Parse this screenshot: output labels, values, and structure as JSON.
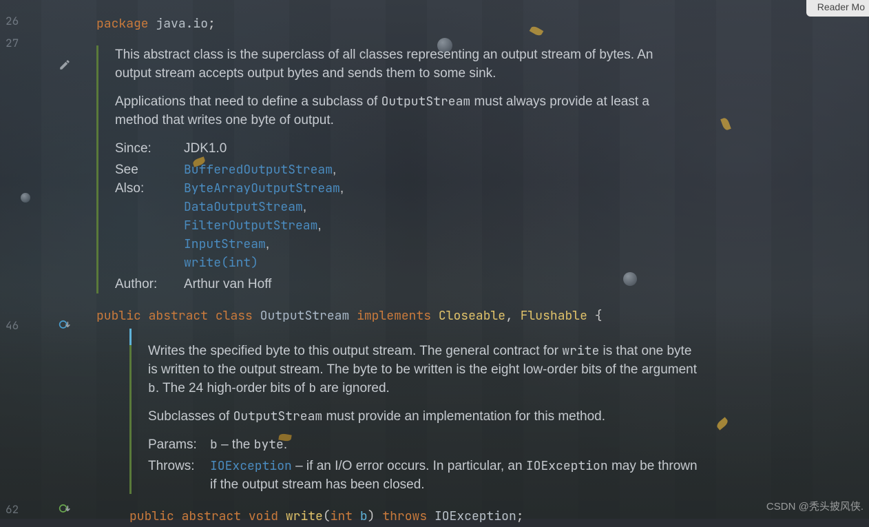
{
  "reader_mode_label": "Reader Mo",
  "line_numbers": {
    "l1": "26",
    "l2": "27",
    "l3": "46",
    "l4": "62"
  },
  "code": {
    "pkg_kw": "package",
    "pkg_name": "java.io",
    "semi": ";",
    "public": "public",
    "abstract": "abstract",
    "class": "class",
    "void": "void",
    "implements": "implements",
    "throws": "throws",
    "OutputStream": "OutputStream",
    "Closeable": "Closeable",
    "Flushable": "Flushable",
    "comma_sp": ", ",
    "lbrace": " {",
    "write": "write",
    "lparen": "(",
    "int": "int",
    "b": "b",
    "rparen": ")",
    "IOException": "IOException"
  },
  "doc1": {
    "p1": "This abstract class is the superclass of all classes representing an output stream of bytes. An output stream accepts output bytes and sends them to some sink.",
    "p2a": "Applications that need to define a subclass of ",
    "p2b": " must always provide at least a method that writes one byte of output.",
    "since_label": "Since:",
    "since_val": "JDK1.0",
    "see_label": "See Also:",
    "see_links": [
      "BufferedOutputStream",
      "ByteArrayOutputStream",
      "DataOutputStream",
      "FilterOutputStream",
      "InputStream",
      "write(int)"
    ],
    "author_label": "Author:",
    "author_val": "Arthur van Hoff"
  },
  "doc2": {
    "p1a": "Writes the specified byte to this output stream. The general contract for ",
    "p1b": " is that one byte is written to the output stream. The byte to be written is the eight low-order bits of the argument ",
    "p1c": ". The 24 high-order bits of ",
    "p1d": " are ignored.",
    "p2a": "Subclasses of ",
    "p2b": " must provide an implementation for this method.",
    "params_label": "Params:",
    "param_name": "b",
    "param_dash": " – the ",
    "param_type": "byte",
    "param_dot": ".",
    "throws_label": "Throws:",
    "throws_link": "IOException",
    "throws_text1": " – if an I/O error occurs. In particular, an ",
    "throws_mono": "IOException",
    "throws_text2": " may be thrown if the output stream has been closed."
  },
  "watermark": "CSDN @秃头披风侠."
}
